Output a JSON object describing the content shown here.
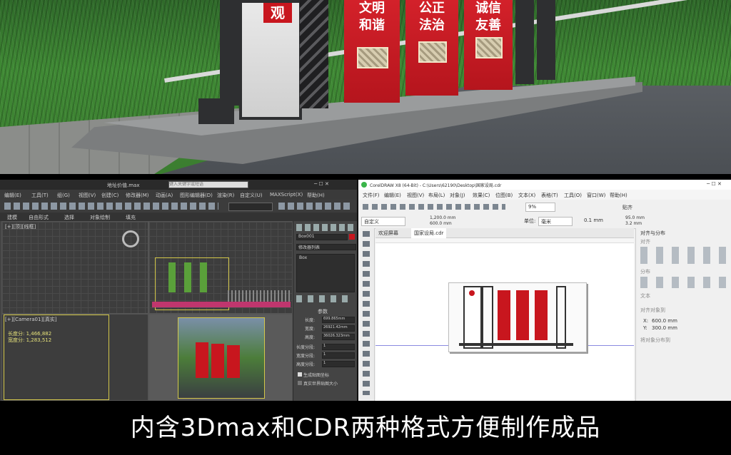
{
  "render": {
    "sign_left_char": "观",
    "panels": [
      {
        "top": "文明",
        "bottom": "和谐"
      },
      {
        "top": "公正",
        "bottom": "法治"
      },
      {
        "top": "诚信",
        "bottom": "友善"
      }
    ]
  },
  "max": {
    "title": "地址价值.max",
    "search_placeholder": "键入关键字或短语",
    "menu": [
      "编辑(E)",
      "工具(T)",
      "组(G)",
      "视图(V)",
      "创建(C)",
      "修改器(M)",
      "动画(A)",
      "图形编辑器(D)",
      "渲染(R)",
      "自定义(U)",
      "MAXScript(X)",
      "帮助(H)"
    ],
    "tabs": [
      "建模",
      "自由形式",
      "选择",
      "对象绘制",
      "填充"
    ],
    "vp_top_label": "[+][顶][线框]",
    "vp_persp_label": "[+][Camera01][真实]",
    "coords": [
      "长度分: 1,466,882",
      "宽度分: 1,283,512"
    ],
    "cmd": {
      "name": "Box001",
      "modifier_list": "修改器列表",
      "stack_item": "Box",
      "params_title": "参数",
      "params": [
        {
          "label": "长度:",
          "value": "699.865mm"
        },
        {
          "label": "宽度:",
          "value": "26921.42mm"
        },
        {
          "label": "高度:",
          "value": "36026.323mm"
        },
        {
          "label": "长度分段:",
          "value": "1"
        },
        {
          "label": "宽度分段:",
          "value": "1"
        },
        {
          "label": "高度分段:",
          "value": "1"
        }
      ],
      "check1": "生成贴图坐标",
      "check2": "真实世界贴图大小"
    }
  },
  "cdr": {
    "title": "CorelDRAW X8 (64-Bit) - C:\\Users\\62190\\Desktop\\国家设局.cdr",
    "menu": [
      "文件(F)",
      "编辑(E)",
      "视图(V)",
      "布局(L)",
      "对象(J)",
      "效果(C)",
      "位图(B)",
      "文本(X)",
      "表格(T)",
      "工具(O)",
      "窗口(W)",
      "帮助(H)"
    ],
    "zoom": "9%",
    "snap": "贴齐",
    "preset": "自定义",
    "width": "1,200.0 mm",
    "height": "600.0 mm",
    "unit_label": "单位:",
    "unit": "毫米",
    "nudge": "0.1 mm",
    "dup_x": "95.0 mm",
    "dup_y": "3.2 mm",
    "tab_welcome": "欢迎屏幕",
    "tab_doc": "国家设局.cdr",
    "docker_title": "对齐与分布",
    "docker_sections": [
      "对齐",
      "分布",
      "文本",
      "对齐对象到",
      "将对象分布到"
    ],
    "x_label": "X:",
    "x_value": "600.0 mm",
    "y_label": "Y:",
    "y_value": "300.0 mm"
  },
  "caption": "内含3Dmax和CDR两种格式方便制作成品"
}
